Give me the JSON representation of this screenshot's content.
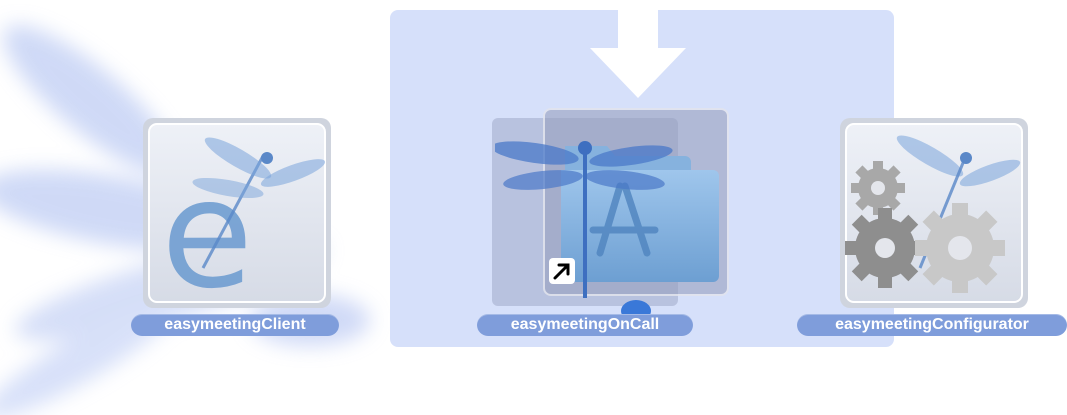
{
  "icons": {
    "client": {
      "label": "easymeetingClient"
    },
    "oncall": {
      "label": "easymeetingOnCall"
    },
    "configurator": {
      "label": "easymeetingConfigurator"
    }
  },
  "colors": {
    "drop_zone": "#c6d4f8",
    "label_bg": "#7f9ddb",
    "folder_blue": "#7fb0dd",
    "dragonfly_blue": "#4a78c8"
  }
}
